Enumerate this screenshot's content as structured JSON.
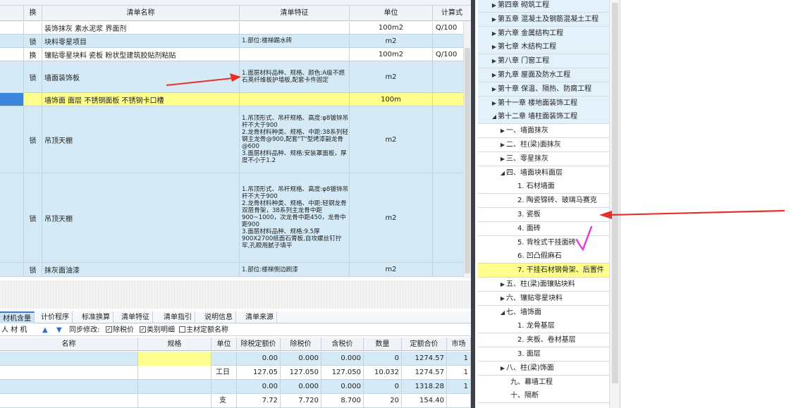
{
  "columns": {
    "swap": "换",
    "name": "清单名称",
    "features": "清单特征",
    "unit": "单位",
    "formula": "计算式"
  },
  "rows": [
    {
      "ch": "",
      "name": "装饰抹灰 素水泥浆 界面剂",
      "feat": "",
      "unit": "100m2",
      "fx": "Q/100"
    },
    {
      "ch": "锁",
      "name": "块料零星项目",
      "feat": "1.部位:楼梯踢水砖",
      "unit": "m2",
      "fx": ""
    },
    {
      "ch": "换",
      "name": "镶贴零星块料 瓷板 粉状型建筑胶贴剂粘贴",
      "feat": "",
      "unit": "100m2",
      "fx": "Q/100"
    },
    {
      "ch": "锁",
      "name": "墙面装饰板",
      "feat": "1.面层材料品种、规格、颜色:A级不燃石英纤维板护墙板,配套卡件固定",
      "unit": "m2",
      "fx": ""
    },
    {
      "ch": "",
      "name": "墙饰面 面层 不锈钢面板 不锈钢卡口槽",
      "feat": "",
      "unit": "100m",
      "fx": ""
    },
    {
      "ch": "锁",
      "name": "吊顶天棚",
      "feat": "1.吊顶形式、吊杆规格、高度:φ8镀锌吊杆不大于900\n2.龙骨材料种类、规格、中距:38系列轻钢主龙骨@900,配套\"T\"型烤漆副龙骨@600\n3.面层材料品种、规格:安装罩面板，厚度不小于1.2",
      "unit": "m2",
      "fx": ""
    },
    {
      "ch": "锁",
      "name": "吊顶天棚",
      "feat": "1.吊顶形式、吊杆规格、高度:φ8镀锌吊杆不大于900\n2.龙骨材料种类、规格、中距:轻钢龙骨双层骨架，38系列主龙骨中距900~1000，次龙骨中距450，龙骨中距900\n3.面层材料品种、规格:9.5厚900X2700纸面石膏板,自攻螺丝钉拧牢,孔眼用腻子填平",
      "unit": "m2",
      "fx": ""
    },
    {
      "ch": "锁",
      "name": "抹灰面油漆",
      "feat": "1.部位:楼梯侧边刷漆",
      "unit": "m2",
      "fx": ""
    }
  ],
  "tabs": [
    "材机含量",
    "计价程序",
    "标准换算",
    "清单特征",
    "清单指引",
    "说明信息",
    "清单来源"
  ],
  "toolbar2": {
    "a": "人 材 机",
    "sync": "同步修改:",
    "opt1": "除税价",
    "opt2": "类别明细",
    "opt3": "主材定额名称"
  },
  "bottom_cols": [
    "名称",
    "规格",
    "单位",
    "除税定额价",
    "除税价",
    "含税价",
    "数量",
    "定额合价",
    "市场"
  ],
  "bottom_rows": [
    [
      "",
      "",
      "",
      "0.00",
      "0.000",
      "0.000",
      "0",
      "1274.57",
      "1"
    ],
    [
      "",
      "",
      "工日",
      "127.05",
      "127.050",
      "127.050",
      "10.032",
      "1274.57",
      "1"
    ],
    [
      "",
      "",
      "",
      "0.00",
      "0.000",
      "0.000",
      "0",
      "1318.28",
      "1"
    ],
    [
      "",
      "",
      "支",
      "7.72",
      "7.720",
      "8.700",
      "20",
      "154.40",
      ""
    ]
  ],
  "tree": [
    {
      "label": "第四章 砌筑工程",
      "arrow": "▶",
      "lvl": 0,
      "kind": "ch"
    },
    {
      "label": "第五章 混凝土及钢筋混凝土工程",
      "arrow": "▶",
      "lvl": 0,
      "kind": "ch"
    },
    {
      "label": "第六章 金属结构工程",
      "arrow": "▶",
      "lvl": 0,
      "kind": "ch"
    },
    {
      "label": "第七章 木结构工程",
      "arrow": "▶",
      "lvl": 0,
      "kind": "ch"
    },
    {
      "label": "第八章 门窗工程",
      "arrow": "▶",
      "lvl": 0,
      "kind": "ch"
    },
    {
      "label": "第九章 屋面及防水工程",
      "arrow": "▶",
      "lvl": 0,
      "kind": "ch"
    },
    {
      "label": "第十章 保温、隔热、防腐工程",
      "arrow": "▶",
      "lvl": 0,
      "kind": "ch"
    },
    {
      "label": "第十一章 楼地面装饰工程",
      "arrow": "▶",
      "lvl": 0,
      "kind": "ch"
    },
    {
      "label": "第十二章 墙柱面装饰工程",
      "arrow": "◢",
      "lvl": 0,
      "kind": "ch"
    },
    {
      "label": "一、墙面抹灰",
      "arrow": "▶",
      "lvl": 1,
      "kind": "sub"
    },
    {
      "label": "二、柱(梁)面抹灰",
      "arrow": "▶",
      "lvl": 1,
      "kind": "sub"
    },
    {
      "label": "三、零星抹灰",
      "arrow": "▶",
      "lvl": 1,
      "kind": "sub"
    },
    {
      "label": "四、墙面块料面层",
      "arrow": "◢",
      "lvl": 1,
      "kind": "sub"
    },
    {
      "label": "1. 石材墙面",
      "arrow": "",
      "lvl": 2,
      "kind": "sub"
    },
    {
      "label": "2. 陶瓷锦砖、玻璃马赛克",
      "arrow": "",
      "lvl": 2,
      "kind": "sub"
    },
    {
      "label": "3. 瓷板",
      "arrow": "",
      "lvl": 2,
      "kind": "sub"
    },
    {
      "label": "4. 面砖",
      "arrow": "",
      "lvl": 2,
      "kind": "sub"
    },
    {
      "label": "5. 背栓式干挂面砖",
      "arrow": "",
      "lvl": 2,
      "kind": "sub"
    },
    {
      "label": "6. 凹凸假麻石",
      "arrow": "",
      "lvl": 2,
      "kind": "sub"
    },
    {
      "label": "7. 干挂石材钢骨架、后置件",
      "arrow": "",
      "lvl": 2,
      "kind": "hl"
    },
    {
      "label": "五、柱(梁)面镶贴块料",
      "arrow": "▶",
      "lvl": 1,
      "kind": "sub"
    },
    {
      "label": "六、镶贴零星块料",
      "arrow": "▶",
      "lvl": 1,
      "kind": "sub"
    },
    {
      "label": "七、墙饰面",
      "arrow": "◢",
      "lvl": 1,
      "kind": "sub"
    },
    {
      "label": "1. 龙骨基层",
      "arrow": "",
      "lvl": 2,
      "kind": "sub"
    },
    {
      "label": "2. 夹板、卷材基层",
      "arrow": "",
      "lvl": 2,
      "kind": "sub"
    },
    {
      "label": "3. 面层",
      "arrow": "",
      "lvl": 2,
      "kind": "sub"
    },
    {
      "label": "八、柱(梁)饰面",
      "arrow": "▶",
      "lvl": 1,
      "kind": "sub"
    },
    {
      "label": "九、幕墙工程",
      "arrow": "",
      "lvl": 1,
      "kind": "sub"
    },
    {
      "label": "十、隔断",
      "arrow": "",
      "lvl": 1,
      "kind": "sub"
    }
  ],
  "colors": {
    "annotation_arrow": "#e8302a",
    "checkmark": "#e040e0",
    "highlight": "#ffff8f",
    "rowblue": "#d4ebf7"
  }
}
